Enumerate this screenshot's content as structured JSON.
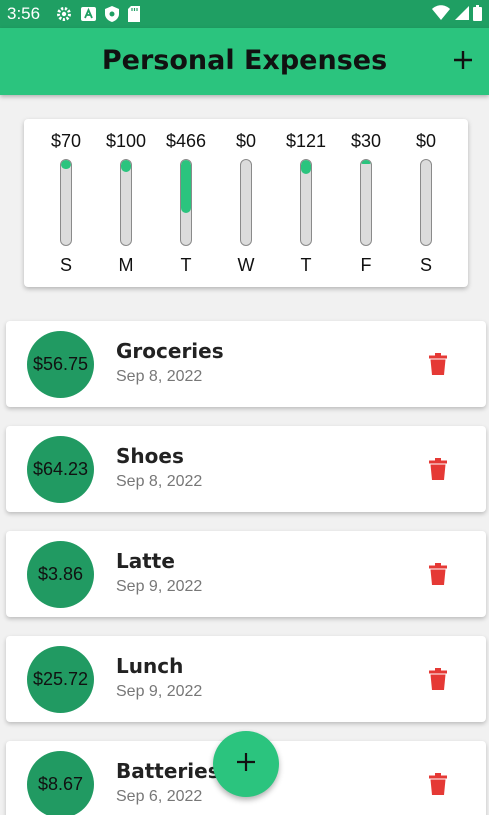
{
  "status_bar": {
    "time": "3:56",
    "icons": [
      "gear-icon",
      "a-icon",
      "shield-icon",
      "sdcard-icon",
      "wifi-icon",
      "signal-icon",
      "battery-icon"
    ]
  },
  "app_bar": {
    "title": "Personal Expenses",
    "add_icon": "plus-icon"
  },
  "chart": {
    "days": [
      {
        "amount": "$70",
        "day": "S",
        "fill_pct": 0.1
      },
      {
        "amount": "$100",
        "day": "M",
        "fill_pct": 0.14
      },
      {
        "amount": "$466",
        "day": "T",
        "fill_pct": 0.62
      },
      {
        "amount": "$0",
        "day": "W",
        "fill_pct": 0.0
      },
      {
        "amount": "$121",
        "day": "T",
        "fill_pct": 0.16
      },
      {
        "amount": "$30",
        "day": "F",
        "fill_pct": 0.04
      },
      {
        "amount": "$0",
        "day": "S",
        "fill_pct": 0.0
      }
    ]
  },
  "transactions": [
    {
      "amount": "$56.75",
      "title": "Groceries",
      "date": "Sep 8, 2022"
    },
    {
      "amount": "$64.23",
      "title": "Shoes",
      "date": "Sep 8, 2022"
    },
    {
      "amount": "$3.86",
      "title": "Latte",
      "date": "Sep 9, 2022"
    },
    {
      "amount": "$25.72",
      "title": "Lunch",
      "date": "Sep 9, 2022"
    },
    {
      "amount": "$8.67",
      "title": "Batteries",
      "date": "Sep 6, 2022"
    }
  ],
  "fab": {
    "icon": "plus-icon"
  },
  "colors": {
    "primary": "#2bc47e",
    "primary_dark": "#1f9f63",
    "avatar": "#219a62",
    "delete": "#e53935"
  }
}
